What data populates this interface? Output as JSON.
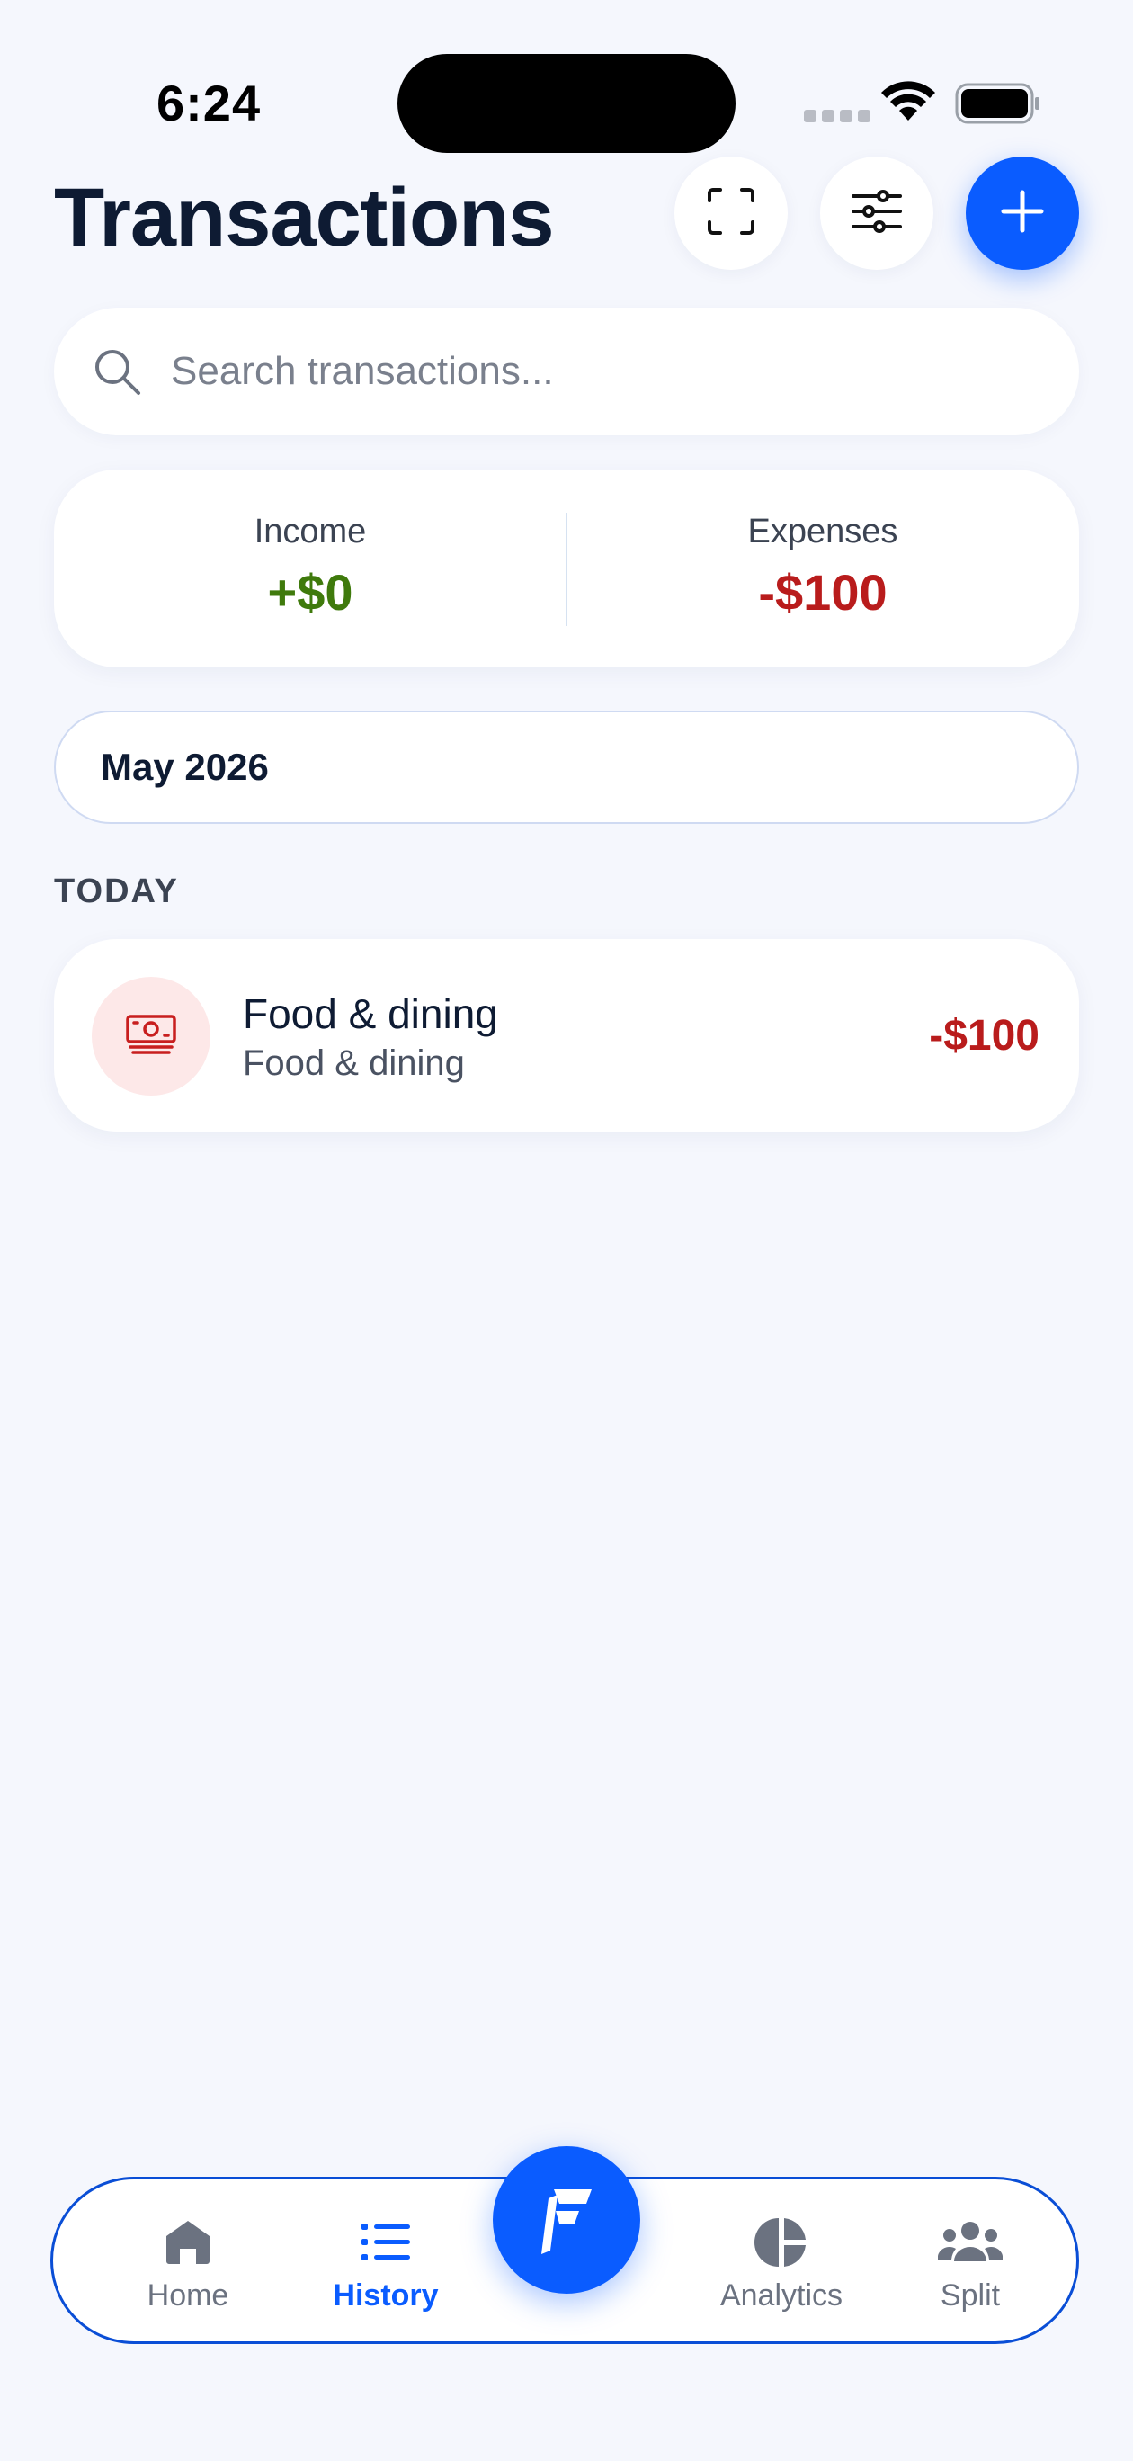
{
  "status_bar": {
    "time": "6:24"
  },
  "header": {
    "title": "Transactions"
  },
  "search": {
    "placeholder": "Search transactions...",
    "value": ""
  },
  "summary": {
    "income_label": "Income",
    "income_value": "+$0",
    "expenses_label": "Expenses",
    "expenses_value": "-$100"
  },
  "month_selector": {
    "label": "May 2026"
  },
  "sections": [
    {
      "header": "TODAY",
      "transactions": [
        {
          "title": "Food & dining",
          "subtitle": "Food & dining",
          "amount": "-$100",
          "icon": "banknote-icon"
        }
      ]
    }
  ],
  "bottom_nav": {
    "items": [
      {
        "label": "Home",
        "icon": "home-icon",
        "active": false
      },
      {
        "label": "History",
        "icon": "list-icon",
        "active": true
      },
      {
        "label": "Analytics",
        "icon": "pie-chart-icon",
        "active": false
      },
      {
        "label": "Split",
        "icon": "users-icon",
        "active": false
      }
    ],
    "center_button_icon": "app-logo-icon"
  },
  "colors": {
    "accent": "#0a5cff",
    "income": "#3f7a0c",
    "expense": "#b91c1c",
    "background": "#f5f7fd"
  }
}
